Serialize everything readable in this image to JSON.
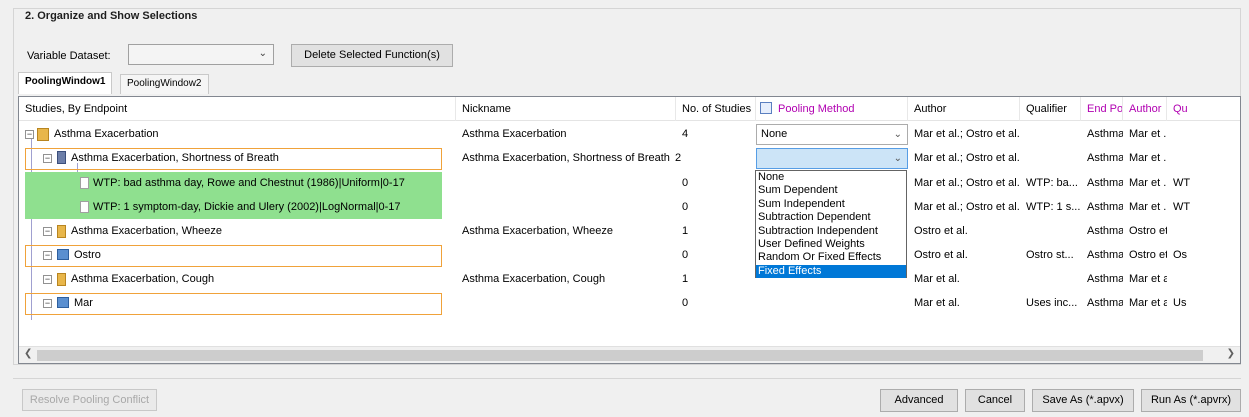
{
  "group": {
    "title": "2. Organize and Show Selections"
  },
  "toolbar": {
    "variable_dataset_label": "Variable Dataset:",
    "variable_dataset_value": "",
    "delete_button": "Delete Selected Function(s)"
  },
  "tabs": [
    {
      "label": "PoolingWindow1",
      "active": true
    },
    {
      "label": "PoolingWindow2",
      "active": false
    }
  ],
  "columns": [
    "Studies, By Endpoint",
    "Nickname",
    "No. of Studies",
    "Pooling Method",
    "Author",
    "Qualifier",
    "End Po...",
    "Author",
    "Qu"
  ],
  "rows": [
    {
      "tree_label": "Asthma Exacerbation",
      "nickname": "Asthma Exacerbation",
      "count": "4",
      "method": "None",
      "author": "Mar et al.; Ostro et al.",
      "qualifier": "",
      "endpoint": "Asthma ...",
      "author2": "Mar et ...",
      "qu": ""
    },
    {
      "tree_label": "Asthma Exacerbation, Shortness of Breath",
      "nickname": "Asthma Exacerbation, Shortness of Breath",
      "count": "2",
      "method": "",
      "author": "Mar et al.; Ostro et al.",
      "qualifier": "",
      "endpoint": "Asthma ...",
      "author2": "Mar et ...",
      "qu": ""
    },
    {
      "tree_label": "WTP: bad asthma day, Rowe and Chestnut (1986)|Uniform|0-17",
      "nickname": "",
      "count": "0",
      "method": "",
      "author": "Mar et al.; Ostro et al.",
      "qualifier": "WTP: ba...",
      "endpoint": "Asthma ...",
      "author2": "Mar et ...",
      "qu": "WT"
    },
    {
      "tree_label": "WTP: 1 symptom-day, Dickie and Ulery (2002)|LogNormal|0-17",
      "nickname": "",
      "count": "0",
      "method": "",
      "author": "Mar et al.; Ostro et al.",
      "qualifier": "WTP: 1 s...",
      "endpoint": "Asthma ...",
      "author2": "Mar et ...",
      "qu": "WT"
    },
    {
      "tree_label": "Asthma Exacerbation, Wheeze",
      "nickname": "Asthma Exacerbation, Wheeze",
      "count": "1",
      "method": "",
      "author": "Ostro et al.",
      "qualifier": "",
      "endpoint": "Asthma ...",
      "author2": "Ostro et...",
      "qu": ""
    },
    {
      "tree_label": "Ostro",
      "nickname": "",
      "count": "0",
      "method": "",
      "author": "Ostro et al.",
      "qualifier": "Ostro st...",
      "endpoint": "Asthma ...",
      "author2": "Ostro et...",
      "qu": "Os"
    },
    {
      "tree_label": "Asthma Exacerbation, Cough",
      "nickname": "Asthma Exacerbation, Cough",
      "count": "1",
      "method": "",
      "author": "Mar et al.",
      "qualifier": "",
      "endpoint": "Asthma ...",
      "author2": "Mar et al.",
      "qu": ""
    },
    {
      "tree_label": "Mar",
      "nickname": "",
      "count": "0",
      "method": "",
      "author": "Mar et al.",
      "qualifier": "Uses inc...",
      "endpoint": "Asthma ...",
      "author2": "Mar et al.",
      "qu": "Us"
    }
  ],
  "pooling_dropdown": {
    "options": [
      "None",
      "Sum Dependent",
      "Sum Independent",
      "Subtraction Dependent",
      "Subtraction Independent",
      "User Defined Weights",
      "Random Or Fixed Effects",
      "Fixed Effects"
    ],
    "highlighted": "Fixed Effects"
  },
  "footer": {
    "resolve": "Resolve Pooling Conflict",
    "advanced": "Advanced",
    "cancel": "Cancel",
    "save_as": "Save As (*.apvx)",
    "run_as": "Run As (*.apvrx)"
  },
  "colors": {
    "selected_green": "#8fe08f",
    "focus_orange": "#f0a23a",
    "header_pink": "#b100b1",
    "dropdown_highlight": "#0078d7"
  }
}
